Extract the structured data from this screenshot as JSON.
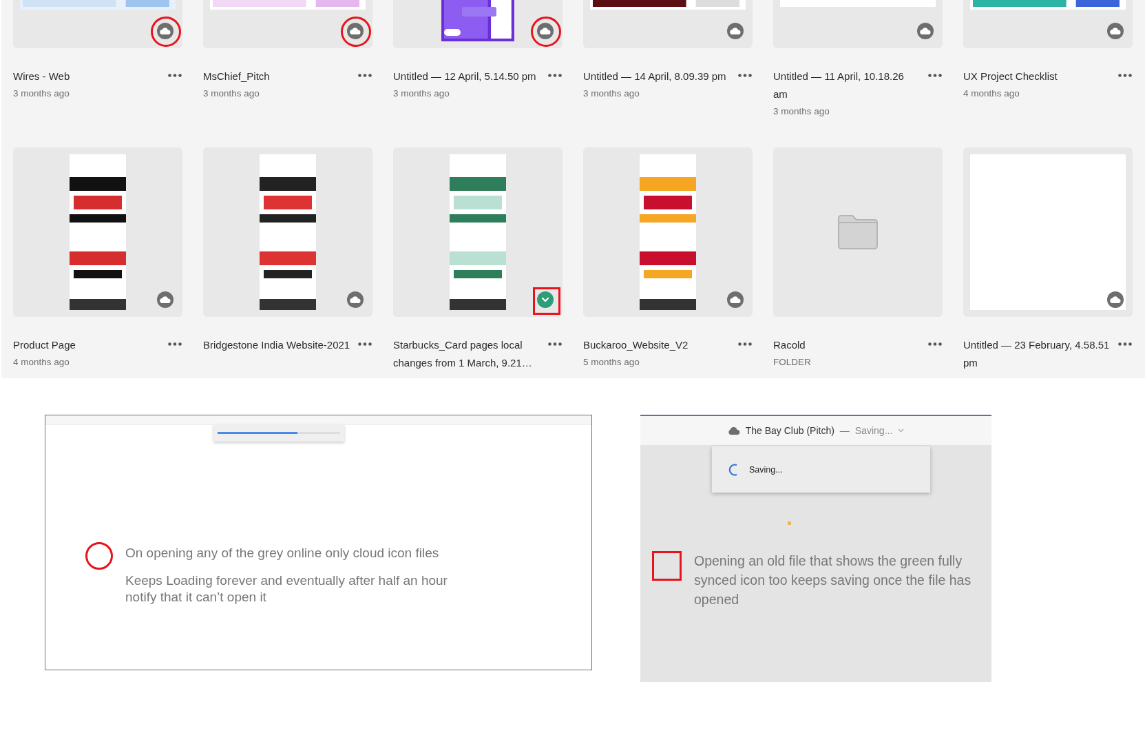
{
  "files": [
    {
      "name": "Wires - Web",
      "meta": "3 months ago",
      "kind": "picture",
      "synced": false,
      "highlighted": true
    },
    {
      "name": "MsChief_Pitch",
      "meta": "3 months ago",
      "kind": "picture",
      "synced": false,
      "highlighted": true
    },
    {
      "name": "Untitled — 12 April, 5.14.50 pm",
      "meta": "3 months ago",
      "kind": "picture",
      "synced": false,
      "highlighted": true
    },
    {
      "name": "Untitled — 14 April, 8.09.39 pm",
      "meta": "3 months ago",
      "kind": "picture",
      "synced": false,
      "highlighted": false
    },
    {
      "name": "Untitled — 11 April, 10.18.26 am",
      "meta": "3 months ago",
      "kind": "blank",
      "synced": false,
      "highlighted": false
    },
    {
      "name": "UX Project Checklist",
      "meta": "4 months ago",
      "kind": "picture",
      "synced": false,
      "highlighted": false
    },
    {
      "name": "Product Page",
      "meta": "4 months ago",
      "kind": "picture",
      "synced": false,
      "highlighted": false
    },
    {
      "name": "Bridgestone India Website-2021",
      "kind": "picture",
      "synced": false,
      "highlighted": false
    },
    {
      "name": "Starbucks_Card pages local changes from 1 March, 9.21…",
      "kind": "picture",
      "synced": true,
      "highlighted": true
    },
    {
      "name": "Buckaroo_Website_V2",
      "meta": "5 months ago",
      "kind": "picture",
      "synced": false,
      "highlighted": false
    },
    {
      "name": "Racold",
      "meta": "FOLDER",
      "kind": "folder"
    },
    {
      "name": "Untitled — 23 February, 4.58.51 pm",
      "kind": "blank",
      "synced": false,
      "highlighted": false
    }
  ],
  "loading_note": {
    "progress": {
      "level": 0.65
    },
    "lines": [
      "On opening any of the grey online only cloud icon files",
      "Keeps Loading forever and eventually after half an hour notify that it can’t open it"
    ]
  },
  "saving_note": {
    "document_title": "The Bay Club (Pitch)",
    "separator": "—",
    "status": "Saving...",
    "popup_text": "Saving...",
    "text": "Opening an old file that shows the green fully synced icon too keeps saving once the file has opened"
  }
}
